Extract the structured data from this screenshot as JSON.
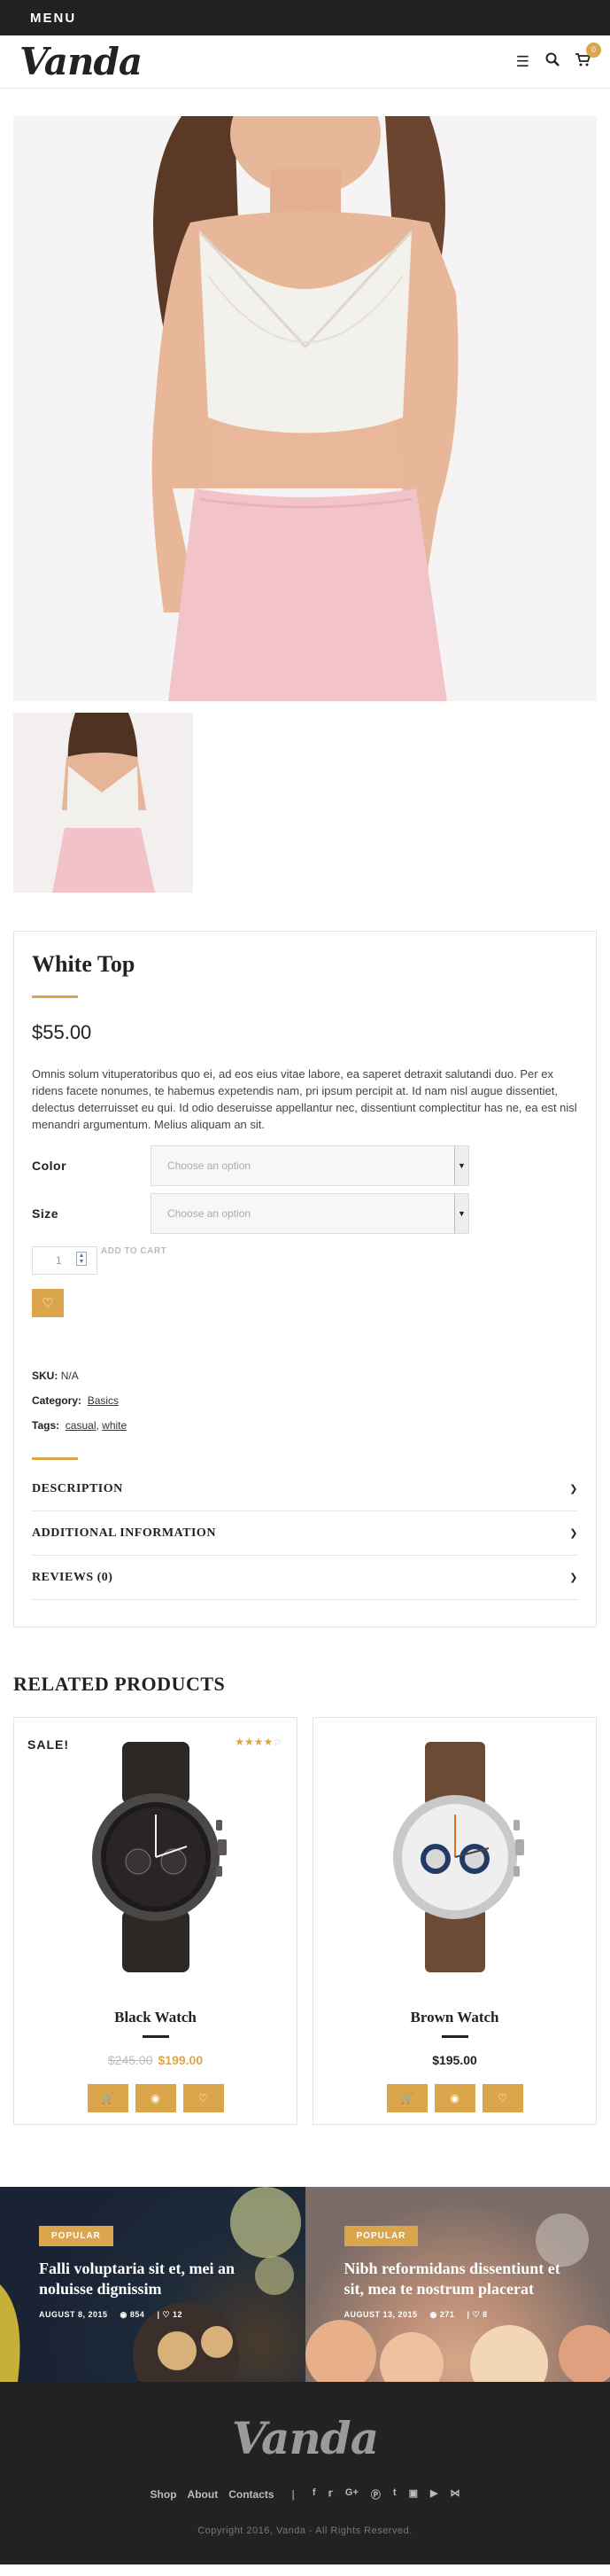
{
  "menubar": {
    "label": "MENU"
  },
  "header": {
    "logo": "Vanda",
    "cart_count": "0"
  },
  "product": {
    "title": "White Top",
    "price": "$55.00",
    "description": "Omnis solum vituperatoribus quo ei, ad eos eius vitae labore, ea saperet detraxit salutandi duo. Per ex ridens facete nonumes, te habemus expetendis nam, pri ipsum percipit at. Id nam nisl augue dissentiet, delectus deterruisset eu qui. Id odio deseruisse appellantur nec, dissentiunt complectitur has ne, ea est nisl menandri argumentum. Melius aliquam an sit.",
    "color_label": "Color",
    "size_label": "Size",
    "select_placeholder": "Choose an option",
    "qty_value": "1",
    "add_to_cart": "ADD TO CART",
    "sku_label": "SKU:",
    "sku_value": "N/A",
    "category_label": "Category:",
    "category_value": "Basics",
    "tags_label": "Tags:",
    "tag1": "casual",
    "tag2": "white",
    "accordion": [
      "DESCRIPTION",
      "ADDITIONAL INFORMATION",
      "REVIEWS (0)"
    ]
  },
  "related": {
    "title": "RELATED PRODUCTS",
    "items": [
      {
        "sale": "SALE!",
        "name": "Black Watch",
        "old_price": "$245.00",
        "price": "$199.00",
        "rating": 4
      },
      {
        "name": "Brown Watch",
        "price": "$195.00"
      }
    ]
  },
  "blog": [
    {
      "badge": "POPULAR",
      "title": "Falli voluptaria sit et, mei an noluisse dignissim",
      "date": "AUGUST 8, 2015",
      "views": "854",
      "likes": "12"
    },
    {
      "badge": "POPULAR",
      "title": "Nibh reformidans dissentiunt et sit, mea te nostrum placerat",
      "date": "AUGUST 13, 2015",
      "views": "271",
      "likes": "8"
    }
  ],
  "footer": {
    "logo": "Vanda",
    "nav": [
      "Shop",
      "About",
      "Contacts"
    ],
    "copyright": "Copyright 2016, Vanda - All Rights Reserved."
  },
  "colors": {
    "accent": "#dba54b",
    "dark": "#222222"
  }
}
